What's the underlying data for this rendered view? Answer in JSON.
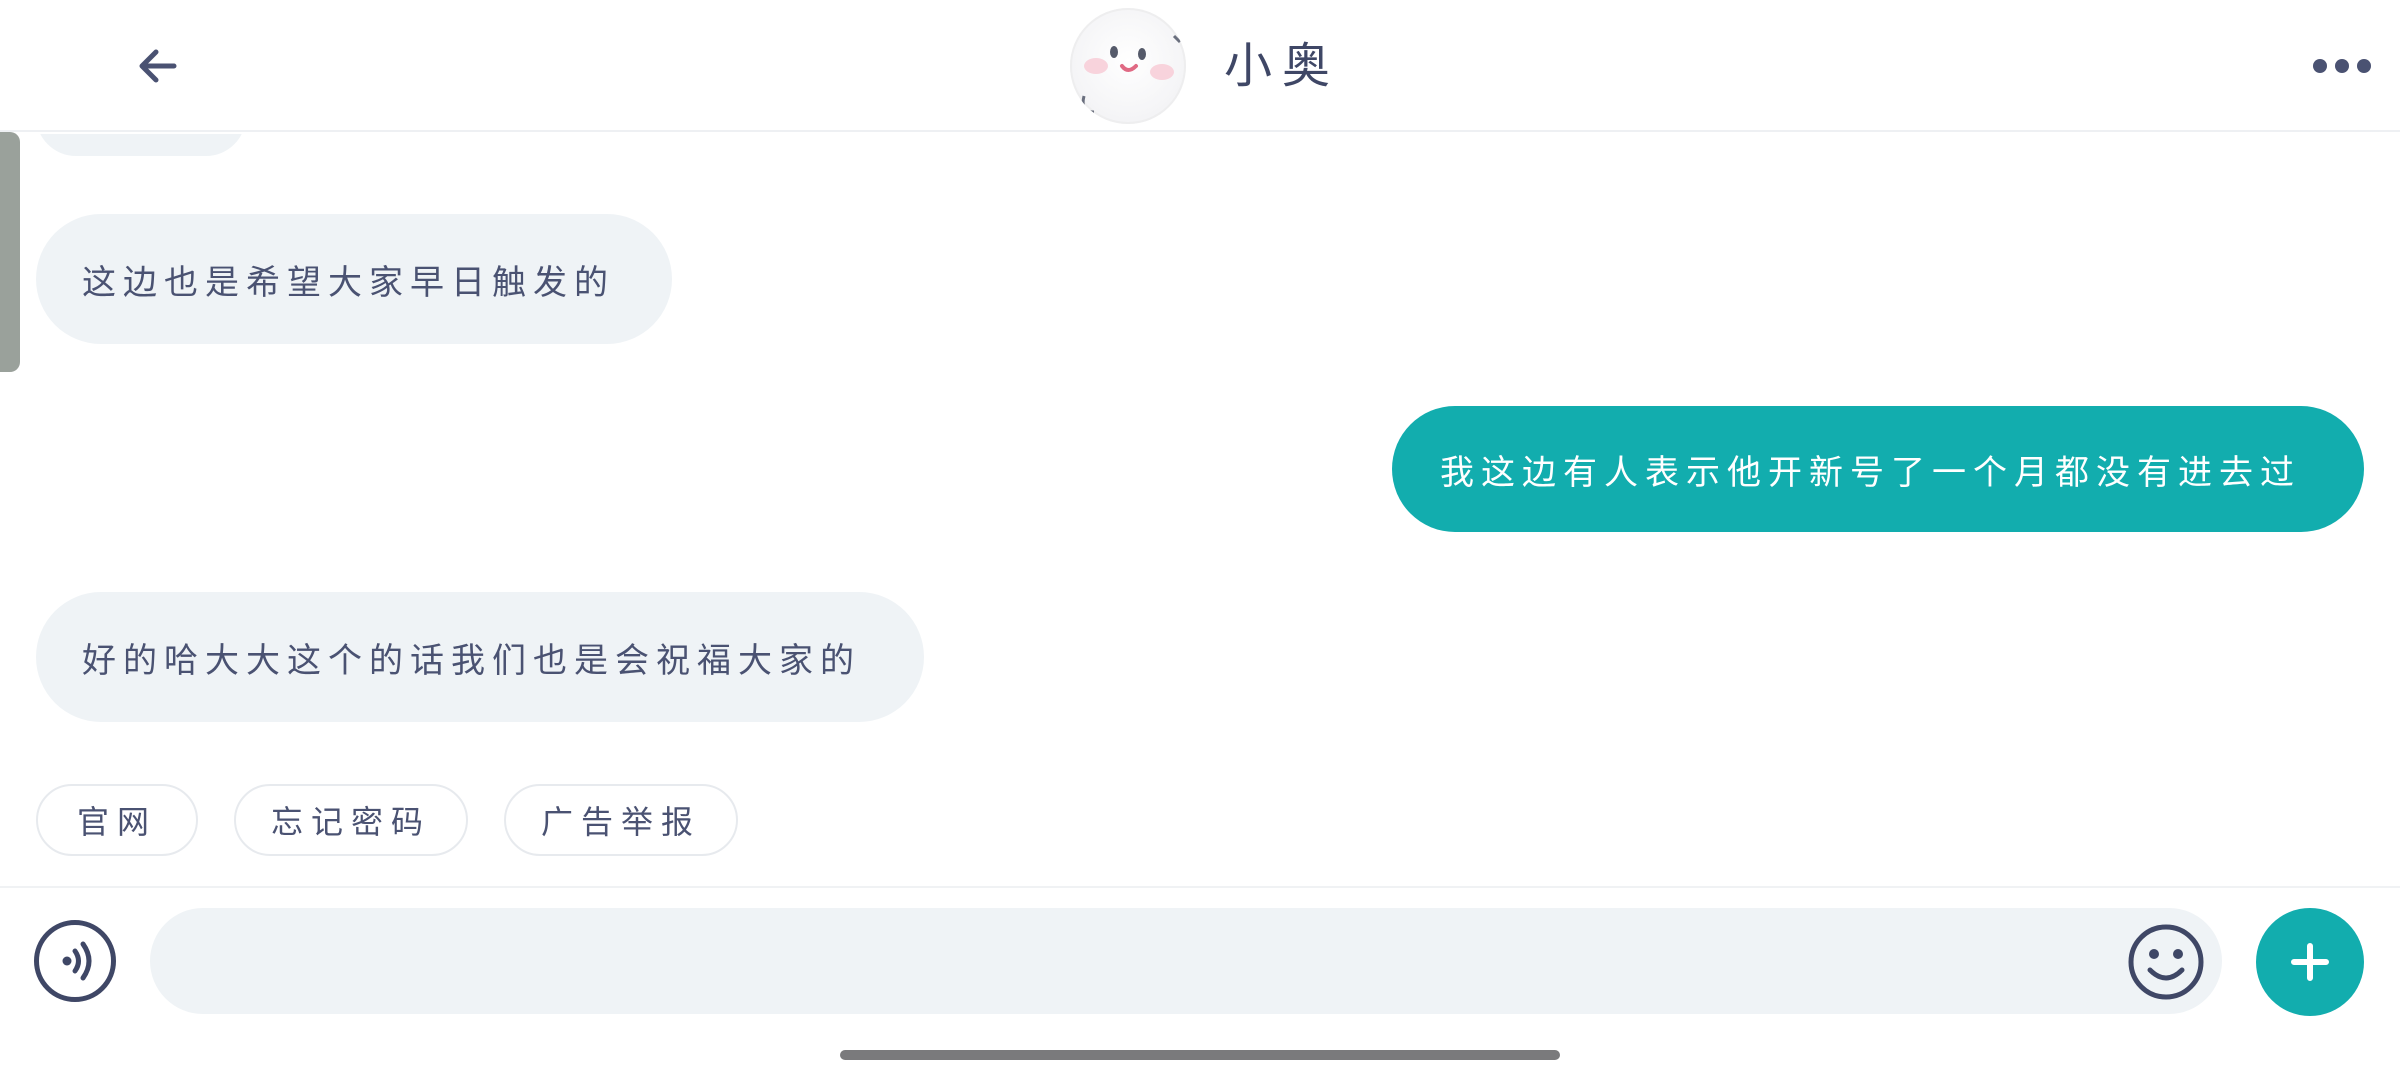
{
  "header": {
    "title": "小奥",
    "back_icon": "arrow-left-icon",
    "more_icon": "more-horizontal-icon"
  },
  "messages": [
    {
      "side": "in",
      "text": "这边也是希望大家早日触发的"
    },
    {
      "side": "out",
      "text": "我这边有人表示他开新号了一个月都没有进去过"
    },
    {
      "side": "in",
      "text": "好的哈大大这个的话我们也是会祝福大家的"
    }
  ],
  "quick_replies": [
    "官网",
    "忘记密码",
    "广告举报"
  ],
  "input": {
    "value": "",
    "placeholder": "",
    "voice_icon": "voice-icon",
    "emoji_icon": "emoji-icon",
    "plus_icon": "plus-icon"
  },
  "colors": {
    "accent": "#12adae",
    "incoming_bubble": "#eff3f6",
    "text": "#3f4766"
  }
}
